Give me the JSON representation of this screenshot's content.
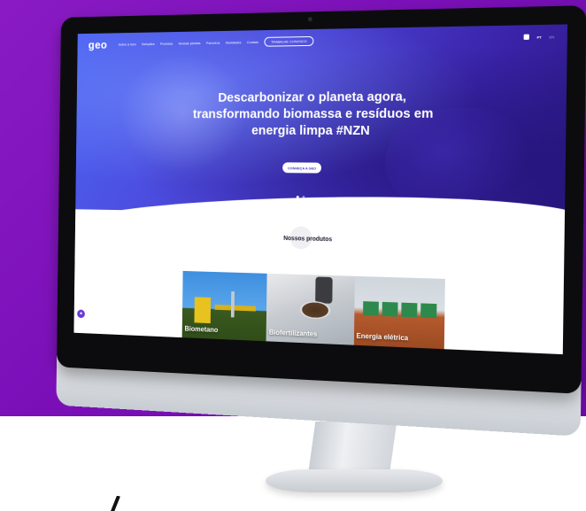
{
  "site": {
    "logo": "geo",
    "nav_items": [
      "Sobre a Geo",
      "Soluções",
      "Produtos",
      "Nossas plantas",
      "Parceiros",
      "Novidades",
      "Contato"
    ],
    "nav_cta": "TRABALHE CONOSCO",
    "languages": {
      "active": "PT",
      "other": "EN"
    }
  },
  "hero": {
    "headline_line1": "Descarbonizar o planeta agora,",
    "headline_line2": "transformando biomassa e resíduos em",
    "headline_line3": "energia limpa #NZN",
    "cta_label": "CONHEÇA A GEO",
    "slides_total": 2,
    "slide_active": 1
  },
  "products": {
    "title": "Nossos produtos",
    "items": [
      {
        "label": "Biometano"
      },
      {
        "label": "Biofertilizantes"
      },
      {
        "label": "Energia elétrica"
      }
    ]
  },
  "colors": {
    "background_purple": "#7a0fb8",
    "hero_blue": "#4b45d8",
    "accent_purple": "#6a39d6"
  },
  "icons": {
    "linkedin": "linkedin-icon",
    "accessibility": "accessibility-icon"
  }
}
